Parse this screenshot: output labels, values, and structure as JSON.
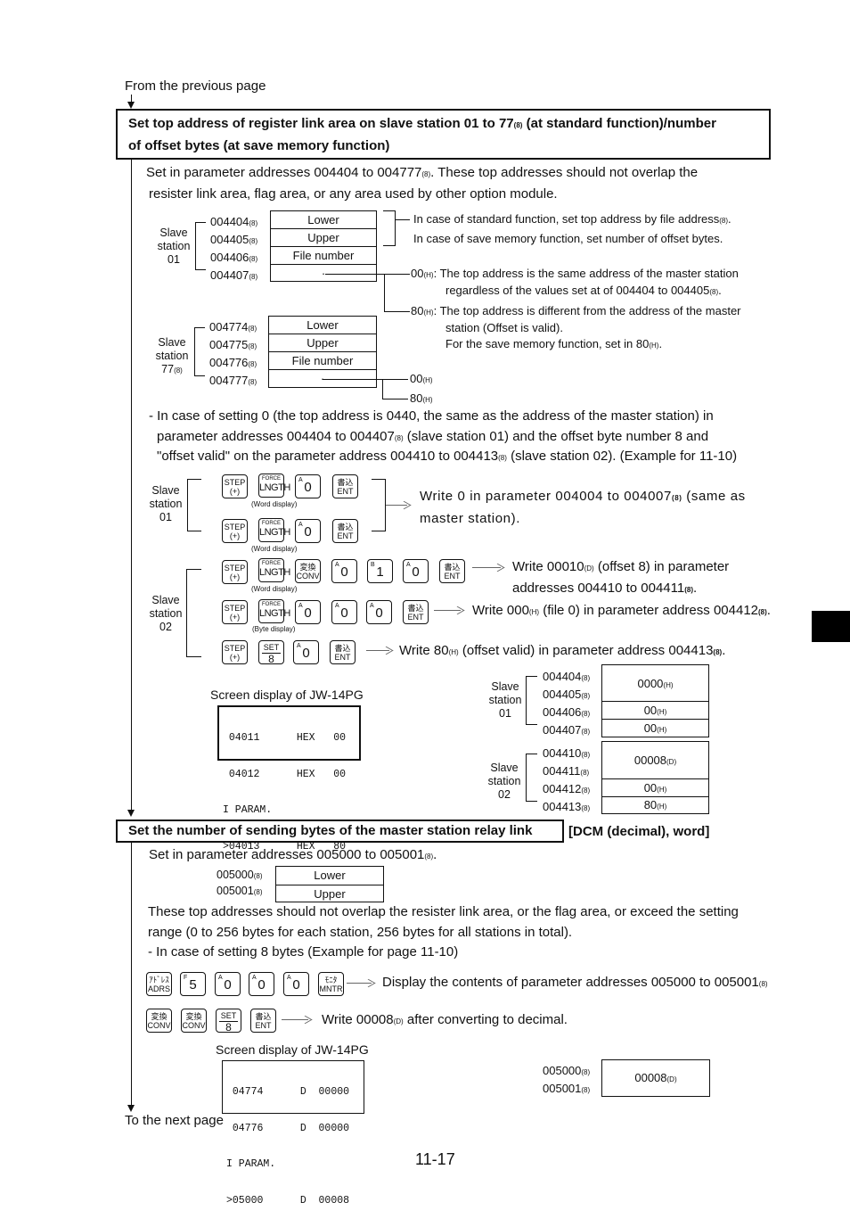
{
  "nav": {
    "from_previous": "From the previous page",
    "to_next": "To the next page"
  },
  "section1": {
    "title_part1": "Set top address of register link area on slave station 01 to 77",
    "title_sub": "(8)",
    "title_part2": " (at standard function)/number",
    "title_line2": "of offset bytes (at save memory function)",
    "intro_line1_a": "Set in parameter addresses 004404 to 004777",
    "intro_line1_sub": "(8)",
    "intro_line1_b": ".  These top addresses should not overlap the",
    "intro_line2": "resister link area, flag area, or any area used by other option module.",
    "station01": {
      "label": [
        "Slave",
        "station",
        "01"
      ],
      "addresses": [
        "004404",
        "004405",
        "004406",
        "004407"
      ],
      "cells": [
        "Lower",
        "Upper",
        "File number",
        "·"
      ]
    },
    "station77": {
      "label": [
        "Slave",
        "station",
        "77"
      ],
      "label_sub": "(8)",
      "addresses": [
        "004774",
        "004775",
        "004776",
        "004777"
      ],
      "cells": [
        "Lower",
        "Upper",
        "File number",
        "·"
      ]
    },
    "addr_sub": "(8)",
    "note_standard_a": "In case of standard function, set top address by file address",
    "note_standard_sub": "(8)",
    "note_standard_b": ".",
    "note_save": "In case of save memory function, set number of offset bytes.",
    "opt00_code": "00",
    "opt80_code": "80",
    "hex_sub": "(H)",
    "opt00_line1": ": The top address is the same address of the master station",
    "opt00_line2_a": "regardless of the values set at of 004404 to 004405",
    "opt00_line2_b": ".",
    "opt80_line1": ": The top address is different from the address of the master",
    "opt80_line2": "station (Offset is valid).",
    "opt80_line3_a": "For the save memory function, set in 80",
    "opt80_line3_b": ".",
    "example_line1": "- In case of setting 0 (the top address is   0440, the same as the address of the master station) in",
    "example_line2_a": "parameter addresses 004404 to 004407",
    "example_line2_b": " (slave station 01) and the offset byte number 8 and",
    "example_line3_a": "\"offset valid\" on the parameter address 004410 to 004413",
    "example_line3_b": " (slave station 02). (Example for 11-10)",
    "keys": {
      "step_top": "STEP",
      "step_bot": "(+)",
      "force": "FORCE",
      "lngth": "LNGTH",
      "conv_jp": "変換",
      "conv": "CONV",
      "ent_jp": "書込",
      "ent": "ENT",
      "set_top": "SET",
      "set_bot": "8",
      "adrs_jp": "ｱﾄﾞﾚｽ",
      "adrs": "ADRS",
      "mntr_jp": "ﾓﾆﾀ",
      "mntr": "MNTR",
      "key_a": "A",
      "key_b": "B",
      "key_f": "F",
      "zero": "0",
      "one": "1",
      "five": "5"
    },
    "word_display": "(Word display)",
    "byte_display": "(Byte display)",
    "slave01_label": [
      "Slave",
      "station",
      "01"
    ],
    "slave02_label": [
      "Slave",
      "station",
      "02"
    ],
    "result1_line1_a": "Write 0 in parameter 004004 to 004007",
    "result1_line1_sub": "(8)",
    "result1_line1_b": " (same as",
    "result1_line2": "master station).",
    "result2_line1_a": "Write 00010",
    "result2_line1_sub": "(D)",
    "result2_line1_b": " (offset 8) in parameter",
    "result2_line2_a": "addresses 004410 to 004411",
    "result2_line2_b": ".",
    "result3_a": "Write 000",
    "result3_sub": "(H)",
    "result3_b": " (file 0) in parameter address 004412",
    "result3_c": ".",
    "result4_a": "Write 80",
    "result4_sub": "(H)",
    "result4_b": " (offset valid) in parameter address 004413",
    "result4_c": ".",
    "screen_caption": "Screen display of JW-14PG",
    "lcd_lines": [
      " 04011      HEX   00",
      " 04012      HEX   00",
      "I PARAM.",
      ">04013      HEX   80"
    ],
    "result_table": {
      "station01": {
        "label": [
          "Slave",
          "station",
          "01"
        ],
        "addresses": [
          "004404",
          "004405",
          "004406",
          "004407"
        ],
        "values": [
          {
            "v": "0000",
            "u": "(H)"
          },
          {
            "v": "00",
            "u": "(H)"
          },
          {
            "v": "00",
            "u": "(H)"
          }
        ]
      },
      "station02": {
        "label": [
          "Slave",
          "station",
          "02"
        ],
        "addresses": [
          "004410",
          "004411",
          "004412",
          "004413"
        ],
        "values": [
          {
            "v": "00008",
            "u": "(D)"
          },
          {
            "v": "00",
            "u": "(H)"
          },
          {
            "v": "80",
            "u": "(H)"
          }
        ]
      }
    }
  },
  "section2": {
    "title": "Set the number of sending bytes of the master station relay link",
    "title_suffix": "[DCM (decimal), word]",
    "intro_a": "Set in parameter addresses 005000 to 005001",
    "intro_b": ".",
    "addresses": [
      "005000",
      "005001"
    ],
    "cells": [
      "Lower",
      "Upper"
    ],
    "note_line1": "These top addresses should not overlap the resister link area, or the flag area, or exceed the setting",
    "note_line2": "range (0 to 256 bytes for each station, 256 bytes for all stations in total).",
    "note_line3": "- In case of setting 8 bytes (Example for page 11-10)",
    "step1_text_a": "Display the contents of parameter addresses 005000 to 005001",
    "step2_text_a": "Write 00008",
    "step2_text_sub": "(D)",
    "step2_text_b": " after converting to decimal.",
    "screen_caption": "Screen display of JW-14PG",
    "lcd_lines": [
      " 04774      D  00000",
      " 04776      D  00000",
      "I PARAM.",
      ">05000      D  00008"
    ],
    "result_addresses": [
      "005000",
      "005001"
    ],
    "result_value": "00008",
    "result_unit": "(D)"
  },
  "footer": {
    "page_number": "11-17"
  }
}
